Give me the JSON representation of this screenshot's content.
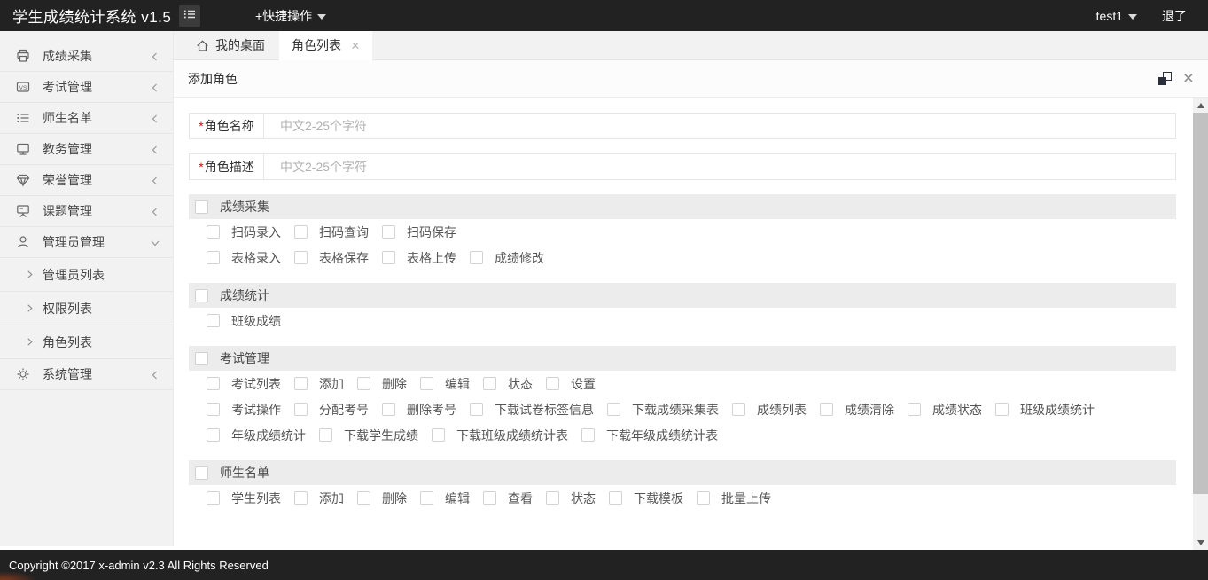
{
  "topbar": {
    "title": "学生成绩统计系统 v1.5",
    "quick_menu": "+快捷操作",
    "user": "test1",
    "logout": "退了"
  },
  "sidebar": {
    "items": [
      {
        "label": "成绩采集",
        "icon": "printer-icon",
        "state": "collapsed"
      },
      {
        "label": "考试管理",
        "icon": "vs-badge-icon",
        "state": "collapsed"
      },
      {
        "label": "师生名单",
        "icon": "list-icon",
        "state": "collapsed"
      },
      {
        "label": "教务管理",
        "icon": "monitor-icon",
        "state": "collapsed"
      },
      {
        "label": "荣誉管理",
        "icon": "diamond-icon",
        "state": "collapsed"
      },
      {
        "label": "课题管理",
        "icon": "easel-icon",
        "state": "collapsed"
      },
      {
        "label": "管理员管理",
        "icon": "user-icon",
        "state": "expanded",
        "children": [
          "管理员列表",
          "权限列表",
          "角色列表"
        ]
      },
      {
        "label": "系统管理",
        "icon": "gear-icon",
        "state": "collapsed"
      }
    ]
  },
  "tabs": [
    {
      "label": "我的桌面",
      "icon": "home-icon",
      "closable": false,
      "active": false
    },
    {
      "label": "角色列表",
      "closable": true,
      "active": true
    }
  ],
  "panel": {
    "title": "添加角色"
  },
  "form": {
    "fields": [
      {
        "label": "角色名称",
        "required": true,
        "value": "",
        "placeholder": "中文2-25个字符"
      },
      {
        "label": "角色描述",
        "required": true,
        "value": "",
        "placeholder": "中文2-25个字符"
      }
    ],
    "groups": [
      {
        "title": "成绩采集",
        "checked": false,
        "rows": [
          [
            "扫码录入",
            "扫码查询",
            "扫码保存"
          ],
          [
            "表格录入",
            "表格保存",
            "表格上传",
            "成绩修改"
          ]
        ]
      },
      {
        "title": "成绩统计",
        "checked": false,
        "rows": [
          [
            "班级成绩"
          ]
        ]
      },
      {
        "title": "考试管理",
        "checked": false,
        "rows": [
          [
            "考试列表",
            "添加",
            "删除",
            "编辑",
            "状态",
            "设置"
          ],
          [
            "考试操作",
            "分配考号",
            "删除考号",
            "下载试卷标签信息",
            "下载成绩采集表",
            "成绩列表",
            "成绩清除",
            "成绩状态",
            "班级成绩统计"
          ],
          [
            "年级成绩统计",
            "下载学生成绩",
            "下载班级成绩统计表",
            "下载年级成绩统计表"
          ]
        ]
      },
      {
        "title": "师生名单",
        "checked": false,
        "rows": [
          [
            "学生列表",
            "添加",
            "删除",
            "编辑",
            "查看",
            "状态",
            "下载模板",
            "批量上传"
          ]
        ]
      }
    ]
  },
  "footer": {
    "copyright": "Copyright ©2017 x-admin v2.3 All Rights Reserved"
  },
  "icons": {
    "close": "×"
  },
  "colors": {
    "topbar_bg": "#222222",
    "sidebar_bg": "#f2f2f2",
    "group_header_bg": "#ececec",
    "required_red": "#e60000",
    "scroll_thumb": "#c1c1c1",
    "scroll_track": "#f1f1f1"
  }
}
